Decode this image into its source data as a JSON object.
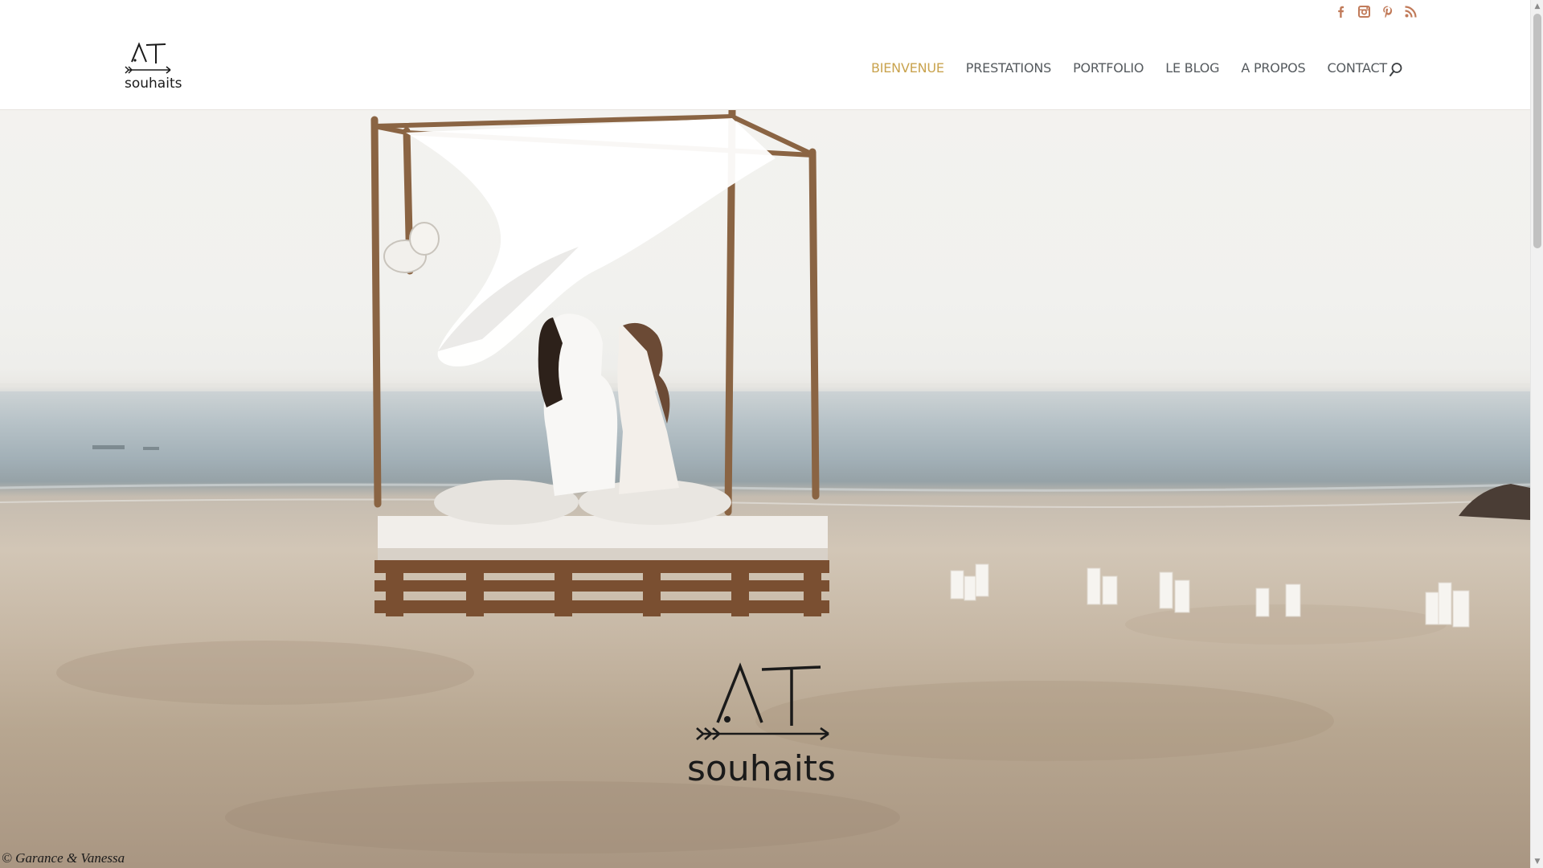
{
  "social": {
    "icons": [
      "facebook-icon",
      "instagram-icon",
      "pinterest-icon",
      "rss-icon"
    ],
    "color": "#c17b5a"
  },
  "header": {
    "logo": {
      "line1": ".AT",
      "line2": "souhaits"
    },
    "nav": [
      {
        "label": "BIENVENUE",
        "active": true
      },
      {
        "label": "PRESTATIONS",
        "active": false
      },
      {
        "label": "PORTFOLIO",
        "active": false
      },
      {
        "label": "LE BLOG",
        "active": false
      },
      {
        "label": "A PROPOS",
        "active": false
      },
      {
        "label": "CONTACT",
        "active": false
      }
    ],
    "search_icon": "search-icon",
    "active_color": "#c9a34e",
    "nav_color": "#555a5e"
  },
  "hero": {
    "logo": {
      "line1": ".AT",
      "line2": "souhaits"
    },
    "credit": "© Garance & Vanessa"
  }
}
